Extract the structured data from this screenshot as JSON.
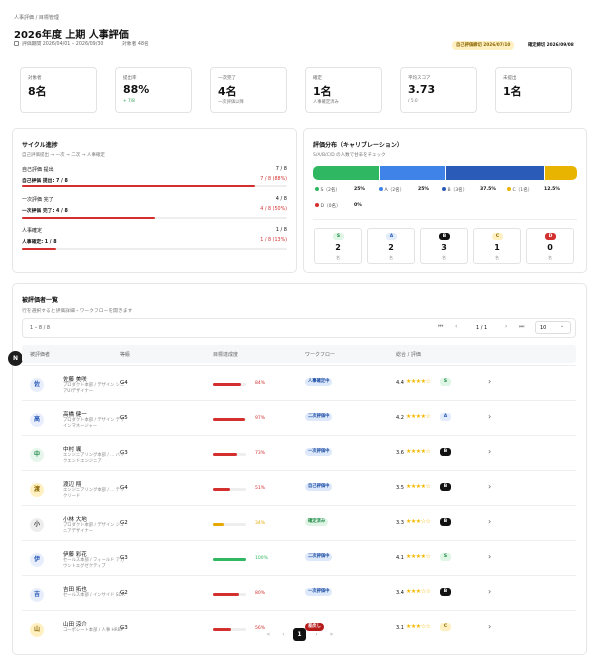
{
  "header": {
    "breadcrumb": "人事評価 / 目標管理",
    "title": "2026年度 上期 人事評価",
    "period": "評価期間 2026/04/01 – 2026/09/30",
    "targets": "対象者 48名",
    "deadline_badge": "自己評価締切 2026/07/10",
    "final_label": "確定締切 2026/09/08"
  },
  "stats": [
    {
      "label": "対象者",
      "value": "8名",
      "sub": ""
    },
    {
      "label": "提出率",
      "value": "88%",
      "sub": "+ 7/8"
    },
    {
      "label": "一次完了",
      "value": "4名",
      "sub": "一次評価以降"
    },
    {
      "label": "確定",
      "value": "1名",
      "sub": "人事確定済み"
    },
    {
      "label": "平均スコア",
      "value": "3.73",
      "sub": "/ 5.0"
    },
    {
      "label": "未提出",
      "value": "1名",
      "sub": ""
    }
  ],
  "cycle": {
    "title": "サイクル進捗",
    "subtitle": "自己評価提出 → 一次 → 二次 → 人事確定",
    "items": [
      {
        "label": "自己評価 提出",
        "count": "7 / 8",
        "bar_label": "自己評価 提出: 7 / 8",
        "pct_label": "7 / 8 (88%)",
        "pct": 88
      },
      {
        "label": "一次評価 完了",
        "count": "4 / 8",
        "bar_label": "一次評価 完了: 4 / 8",
        "pct_label": "4 / 8 (50%)",
        "pct": 50
      },
      {
        "label": "人事確定",
        "count": "1 / 8",
        "bar_label": "人事確定: 1 / 8",
        "pct_label": "1 / 8 (13%)",
        "pct": 13
      }
    ]
  },
  "distribution": {
    "title": "評価分布（キャリブレーション）",
    "subtitle": "S/A/B/C/D の人数で甘辛をチェック",
    "legend": [
      {
        "label": "S（2名）",
        "pct": "25%",
        "value": 25,
        "color": "#2fb861"
      },
      {
        "label": "A（2名）",
        "pct": "25%",
        "value": 25,
        "color": "#3f82e8"
      },
      {
        "label": "B（3名）",
        "pct": "37.5%",
        "value": 37.5,
        "color": "#2a5bb8"
      },
      {
        "label": "C（1名）",
        "pct": "12.5%",
        "value": 12.5,
        "color": "#e8b400"
      },
      {
        "label": "D（0名）",
        "pct": "0%",
        "value": 0,
        "color": "#d32f2f"
      }
    ],
    "grades": [
      {
        "grade": "S",
        "count": "2",
        "unit": "名"
      },
      {
        "grade": "A",
        "count": "2",
        "unit": "名"
      },
      {
        "grade": "B",
        "count": "3",
        "unit": "名"
      },
      {
        "grade": "C",
        "count": "1",
        "unit": "名"
      },
      {
        "grade": "D",
        "count": "0",
        "unit": "名"
      }
    ]
  },
  "list": {
    "title": "被評価者一覧",
    "subtitle": "行を選択すると評価詳細・ワークフローを開きます",
    "range": "1 – 8 / 8",
    "page": "1 / 1",
    "page_size": "10",
    "columns": [
      "被評価者",
      "等級",
      "目標達成度",
      "ワークフロー",
      "総合 / 評価"
    ],
    "rows": [
      {
        "avatar": "佐",
        "name": "佐藤 美咲",
        "dept": "プロダクト本部 / デザイン シニアUIデザイナー",
        "grade": "G4",
        "pct": 84,
        "pct_label": "84%",
        "workflow": "人事確定中",
        "score": "4.4",
        "stars": "★★★★☆",
        "rank": "S"
      },
      {
        "avatar": "高",
        "name": "高橋 健一",
        "dept": "プロダクト本部 / デザイン デザインマネージャー",
        "grade": "G5",
        "pct": 97,
        "pct_label": "97%",
        "workflow": "二次評価中",
        "score": "4.2",
        "stars": "★★★★☆",
        "rank": "A"
      },
      {
        "avatar": "中",
        "name": "中村 颯",
        "dept": "エンジニアリング本部 / ... バックエンドエンジニア",
        "grade": "G3",
        "pct": 73,
        "pct_label": "73%",
        "workflow": "一次評価中",
        "score": "3.6",
        "stars": "★★★★☆",
        "rank": "B"
      },
      {
        "avatar": "渡",
        "name": "渡辺 翔",
        "dept": "エンジニアリング本部 / ... テックリード",
        "grade": "G4",
        "pct": 51,
        "pct_label": "51%",
        "workflow": "自己評価中",
        "score": "3.5",
        "stars": "★★★★☆",
        "rank": "B"
      },
      {
        "avatar": "小",
        "name": "小林 大地",
        "dept": "プロダクト本部 / デザイン ジュニアデザイナー",
        "grade": "G2",
        "pct": 34,
        "pct_label": "34%",
        "workflow": "確定済み",
        "score": "3.3",
        "stars": "★★★☆☆",
        "rank": "B"
      },
      {
        "avatar": "伊",
        "name": "伊藤 彩花",
        "dept": "セールス本部 / フィールド アカウントエグゼクティブ",
        "grade": "G3",
        "pct": 100,
        "pct_label": "100%",
        "workflow": "二次評価中",
        "score": "4.1",
        "stars": "★★★★☆",
        "rank": "S"
      },
      {
        "avatar": "吉",
        "name": "吉田 拓也",
        "dept": "セールス本部 / インサイド SDR",
        "grade": "G2",
        "pct": 80,
        "pct_label": "80%",
        "workflow": "一次評価中",
        "score": "3.4",
        "stars": "★★★☆☆",
        "rank": "B"
      },
      {
        "avatar": "山",
        "name": "山田 涼介",
        "dept": "コーポレート本部 / 人事 HRBP",
        "grade": "G3",
        "pct": 56,
        "pct_label": "56%",
        "workflow": "差戻し",
        "score": "3.1",
        "stars": "★★★☆☆",
        "rank": "C"
      }
    ]
  },
  "pagination": {
    "current": "1"
  },
  "floating_badge": "N"
}
